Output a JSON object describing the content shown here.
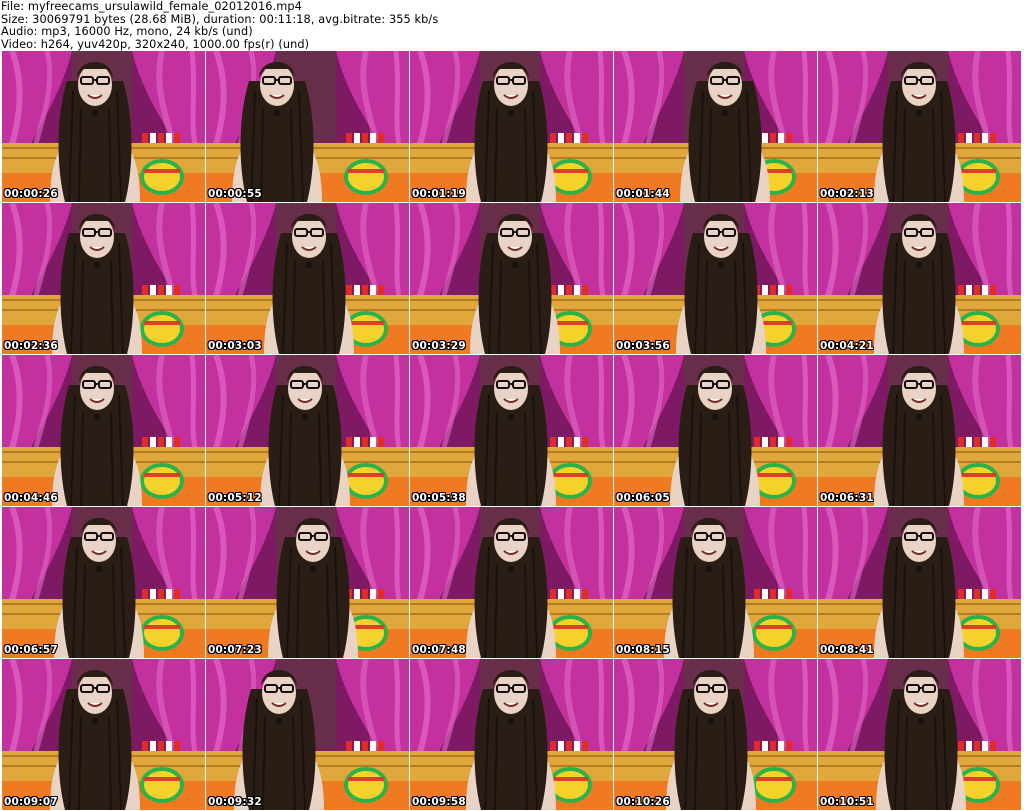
{
  "header": {
    "file_line": "File: myfreecams_ursulawild_female_02012016.mp4",
    "size_line": "Size: 30069791 bytes (28.68 MiB), duration: 00:11:18, avg.bitrate: 355 kb/s",
    "audio_line": "Audio: mp3, 16000 Hz, mono, 24 kb/s (und)",
    "video_line": "Video: h264, yuv420p, 320x240, 1000.00 fps(r) (und)"
  },
  "thumbnails": [
    {
      "timestamp": "00:00:26"
    },
    {
      "timestamp": "00:00:55"
    },
    {
      "timestamp": "00:01:19"
    },
    {
      "timestamp": "00:01:44"
    },
    {
      "timestamp": "00:02:13"
    },
    {
      "timestamp": "00:02:36"
    },
    {
      "timestamp": "00:03:03"
    },
    {
      "timestamp": "00:03:29"
    },
    {
      "timestamp": "00:03:56"
    },
    {
      "timestamp": "00:04:21"
    },
    {
      "timestamp": "00:04:46"
    },
    {
      "timestamp": "00:05:12"
    },
    {
      "timestamp": "00:05:38"
    },
    {
      "timestamp": "00:06:05"
    },
    {
      "timestamp": "00:06:31"
    },
    {
      "timestamp": "00:06:57"
    },
    {
      "timestamp": "00:07:23"
    },
    {
      "timestamp": "00:07:48"
    },
    {
      "timestamp": "00:08:15"
    },
    {
      "timestamp": "00:08:41"
    },
    {
      "timestamp": "00:09:07"
    },
    {
      "timestamp": "00:09:32"
    },
    {
      "timestamp": "00:09:58"
    },
    {
      "timestamp": "00:10:26"
    },
    {
      "timestamp": "00:10:51"
    }
  ],
  "colors": {
    "curtain": "#c2319e",
    "curtain_dark": "#7d1a63",
    "curtain_light": "#e36bc6",
    "wall": "#5a3f35",
    "headboard": "#e0a73c",
    "bedding": "#f07a22",
    "skin": "#e9d3c4",
    "hair": "#2a1d15",
    "text": "#000000"
  }
}
